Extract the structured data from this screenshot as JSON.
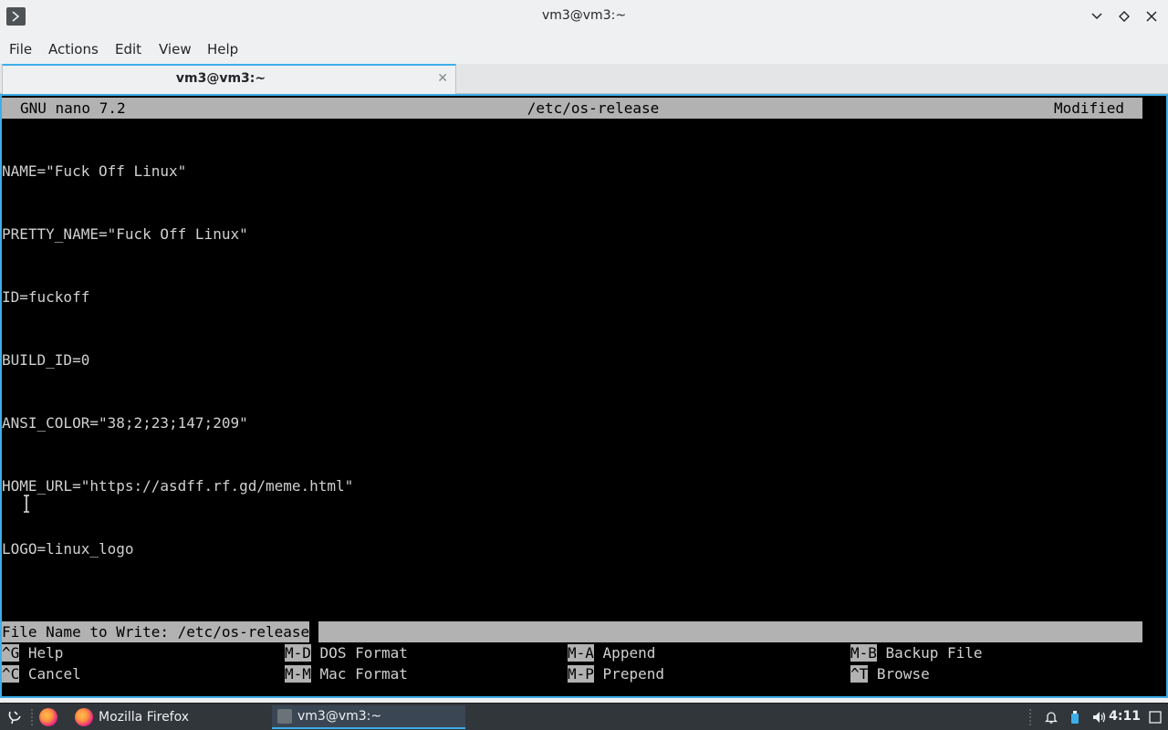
{
  "window": {
    "title": "vm3@vm3:~"
  },
  "menu": [
    "File",
    "Actions",
    "Edit",
    "View",
    "Help"
  ],
  "tab": {
    "label": "vm3@vm3:~"
  },
  "nano": {
    "version": "GNU nano 7.2",
    "filename": "/etc/os-release",
    "status": "Modified",
    "lines": [
      "NAME=\"Fuck Off Linux\"",
      "PRETTY_NAME=\"Fuck Off Linux\"",
      "ID=fuckoff",
      "BUILD_ID=0",
      "ANSI_COLOR=\"38;2;23;147;209\"",
      "HOME_URL=\"https://asdff.rf.gd/meme.html\"",
      "LOGO=linux_logo"
    ],
    "prompt": "File Name to Write: /etc/os-release",
    "shortcuts": [
      {
        "key": "^G",
        "label": "Help"
      },
      {
        "key": "M-D",
        "label": "DOS Format"
      },
      {
        "key": "M-A",
        "label": "Append"
      },
      {
        "key": "M-B",
        "label": "Backup File"
      },
      {
        "key": "^C",
        "label": "Cancel"
      },
      {
        "key": "M-M",
        "label": "Mac Format"
      },
      {
        "key": "M-P",
        "label": "Prepend"
      },
      {
        "key": "^T",
        "label": "Browse"
      }
    ]
  },
  "taskbar": {
    "firefox_label": "Mozilla Firefox",
    "terminal_label": "vm3@vm3:~",
    "clock": "4:11"
  },
  "colors": {
    "accent": "#3daee9",
    "terminal_bg": "#000000",
    "nano_bar": "#b2b2b2"
  }
}
